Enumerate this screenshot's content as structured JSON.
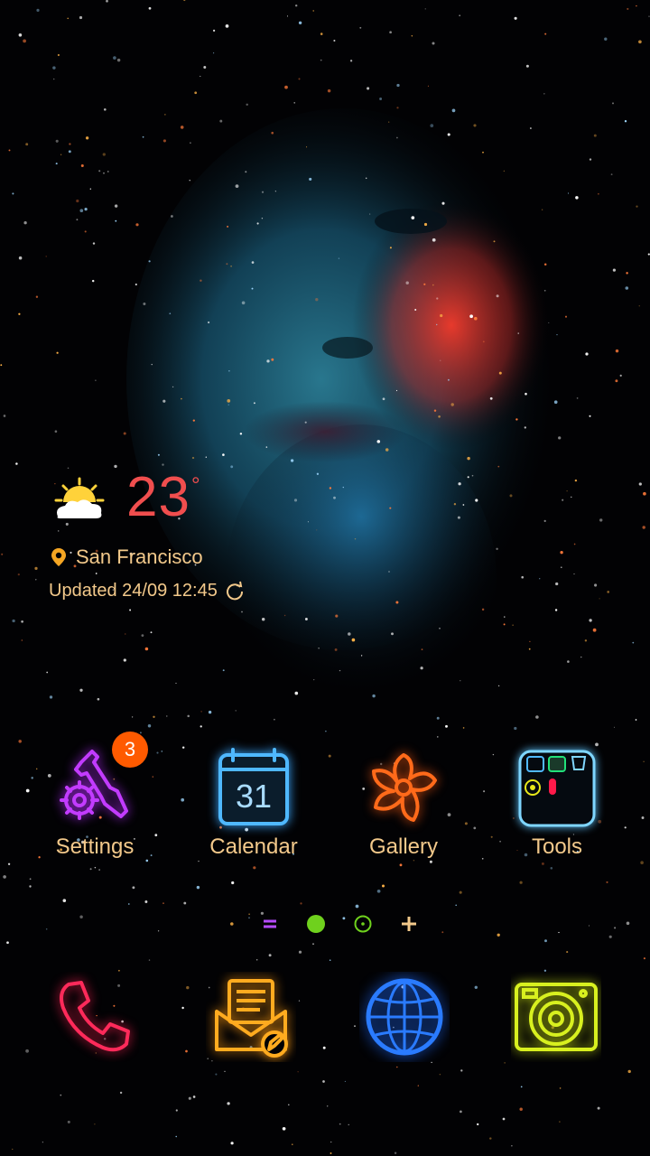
{
  "weather": {
    "temperature": "23",
    "unit": "°",
    "location": "San Francisco",
    "updated": "Updated 24/09 12:45",
    "condition_icon": "partly-cloudy-icon",
    "accent_color": "#f04e4e",
    "text_color": "#f3c98b"
  },
  "apps": [
    {
      "label": "Settings",
      "icon": "wrench-gear-icon",
      "badge": "3",
      "color": "#c23bff"
    },
    {
      "label": "Calendar",
      "icon": "calendar-icon",
      "day": "31",
      "color": "#4fb8ff"
    },
    {
      "label": "Gallery",
      "icon": "flower-icon",
      "color": "#ff6a1a"
    },
    {
      "label": "Tools",
      "icon": "folder-icon",
      "color": "#7fd6ff"
    }
  ],
  "pager": {
    "items": [
      "menu-page-icon",
      "current-page-dot",
      "page-dot",
      "add-page-icon"
    ],
    "active_index": 1,
    "active_color": "#6fd11d"
  },
  "dock": [
    {
      "name": "phone",
      "icon": "phone-icon",
      "color": "#ff2a5a"
    },
    {
      "name": "messages",
      "icon": "envelope-icon",
      "color": "#ffab1f"
    },
    {
      "name": "browser",
      "icon": "globe-icon",
      "color": "#1e6bff"
    },
    {
      "name": "camera",
      "icon": "camera-icon",
      "color": "#d8f01f"
    }
  ]
}
